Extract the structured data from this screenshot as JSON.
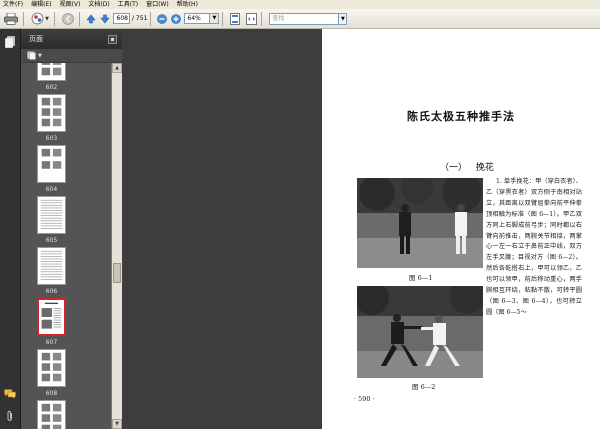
{
  "menu": [
    {
      "label": "文件(F)"
    },
    {
      "label": "编辑(E)"
    },
    {
      "label": "视图(V)"
    },
    {
      "label": "文档(D)"
    },
    {
      "label": "工具(T)"
    },
    {
      "label": "窗口(W)"
    },
    {
      "label": "帮助(H)"
    }
  ],
  "toolbar": {
    "current_page": "608",
    "total_pages": "/ 751",
    "zoom": "64%",
    "search_placeholder": "查找"
  },
  "panel": {
    "title": "页面"
  },
  "thumbnails": [
    {
      "label": "602",
      "kind": "photos3",
      "selected": false
    },
    {
      "label": "603",
      "kind": "photos3",
      "selected": false
    },
    {
      "label": "604",
      "kind": "photos2",
      "selected": false
    },
    {
      "label": "605",
      "kind": "text",
      "selected": false
    },
    {
      "label": "606",
      "kind": "text",
      "selected": false
    },
    {
      "label": "607",
      "kind": "photos2title",
      "selected": true
    },
    {
      "label": "608",
      "kind": "photos3",
      "selected": false
    },
    {
      "label": "609",
      "kind": "photos3",
      "selected": false
    }
  ],
  "document": {
    "title": "陈氏太极五种推手法",
    "section": "（一） 挽花",
    "caption1": "图 6—1",
    "caption2": "图 6—2",
    "paragraph": "1. 单手挽花：甲（穿白衣者）、乙（穿黑衣者）双方侧于南相对站立，其距离以双臂屈拳向前平伸拳顶相触为标准（图 6—1）。甲乙双方同上右脚成前弓步；同时都以右臂向前推击，两腕关节相接，两掌心一左一右立于鼻前正中线，双方左手叉腰；目视对方（图 6—2）。然后各乾搭右上，甲可以领乙，乙也可以领甲，前后移动重心，两手腕相互环绕，粘黏不散，可转平圆（图 6—3、图 6—4），也可转立圆（图 6—5～",
    "page_number": "· 590 ·"
  }
}
